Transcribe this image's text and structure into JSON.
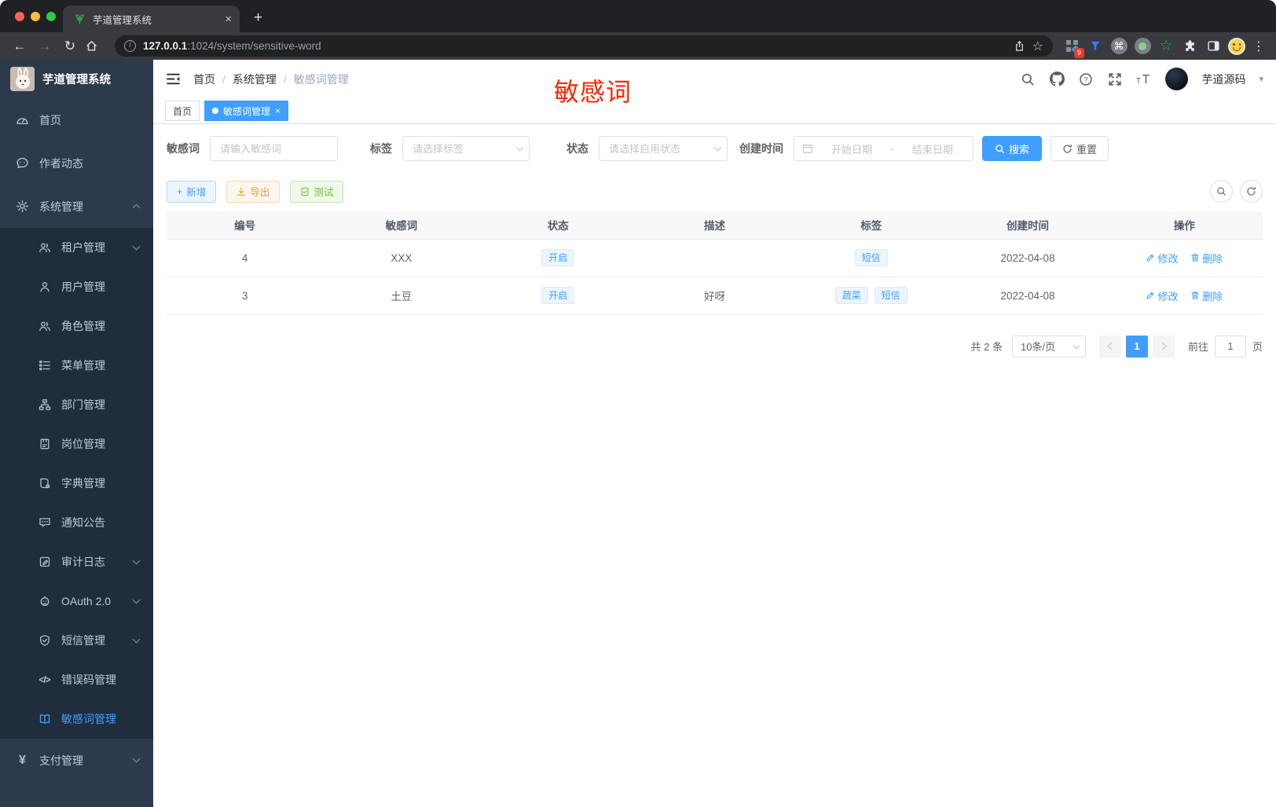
{
  "colors": {
    "accent": "#409eff",
    "annotation_red": "#ff2600",
    "sidebar_bg": "#2d3a4b",
    "submenu_bg": "#1f2d3d"
  },
  "glyphs": {
    "back": "←",
    "forward": "→",
    "reload": "↻",
    "star": "☆",
    "info": "i",
    "plus": "+",
    "close": "×",
    "more": "⋮",
    "cmd": "⌘",
    "caret_down": "▾",
    "slash": "/",
    "code": "</>",
    "yen": "¥",
    "green_star": "☆"
  },
  "browser": {
    "tab_title": "芋道管理系统",
    "url_host": "127.0.0.1",
    "url_rest": ":1024/system/sensitive-word",
    "extension_badge": "9"
  },
  "sidebar": {
    "app_title": "芋道管理系统",
    "items": [
      {
        "label": "首页",
        "icon": "dashboard-icon"
      },
      {
        "label": "作者动态",
        "icon": "chat-icon"
      },
      {
        "label": "系统管理",
        "icon": "gear-icon",
        "expanded": true
      },
      {
        "label": "租户管理",
        "icon": "users-icon",
        "collapsible": true
      },
      {
        "label": "用户管理",
        "icon": "user-icon"
      },
      {
        "label": "角色管理",
        "icon": "users-icon"
      },
      {
        "label": "菜单管理",
        "icon": "tree-list-icon"
      },
      {
        "label": "部门管理",
        "icon": "org-chart-icon"
      },
      {
        "label": "岗位管理",
        "icon": "badge-icon"
      },
      {
        "label": "字典管理",
        "icon": "book-icon"
      },
      {
        "label": "通知公告",
        "icon": "comment-icon"
      },
      {
        "label": "审计日志",
        "icon": "log-icon",
        "collapsible": true
      },
      {
        "label": "OAuth 2.0",
        "icon": "robot-icon",
        "collapsible": true
      },
      {
        "label": "短信管理",
        "icon": "shield-icon",
        "collapsible": true
      },
      {
        "label": "错误码管理",
        "icon": "code-icon"
      },
      {
        "label": "敏感词管理",
        "icon": "open-book-icon",
        "active": true
      },
      {
        "label": "支付管理",
        "icon": "yen-icon",
        "collapsible": true
      }
    ]
  },
  "header": {
    "breadcrumb": {
      "item1": "首页",
      "item2": "系统管理",
      "item3": "敏感词管理"
    },
    "username": "芋道源码"
  },
  "tabs": {
    "home_label": "首页",
    "active_label": "敏感词管理"
  },
  "annotation": {
    "text": "敏感词"
  },
  "filters": {
    "keyword_label": "敏感词",
    "keyword_placeholder": "请输入敏感词",
    "tag_label": "标签",
    "tag_placeholder": "请选择标签",
    "status_label": "状态",
    "status_placeholder": "请选择启用状态",
    "date_label": "创建时间",
    "date_start_placeholder": "开始日期",
    "date_sep": "-",
    "date_end_placeholder": "结束日期",
    "search_label": "搜索",
    "reset_label": "重置"
  },
  "toolbar": {
    "add_label": "新增",
    "export_label": "导出",
    "test_label": "测试"
  },
  "table": {
    "columns": [
      "编号",
      "敏感词",
      "状态",
      "描述",
      "标签",
      "创建时间",
      "操作"
    ],
    "edit_label": "修改",
    "delete_label": "删除",
    "rows": [
      {
        "id": "4",
        "word": "XXX",
        "status": "开启",
        "description": "",
        "tags": {
          "t0": "短信"
        },
        "created": "2022-04-08"
      },
      {
        "id": "3",
        "word": "土豆",
        "status": "开启",
        "description": "好呀",
        "tags": {
          "t0": "蔬菜",
          "t1": "短信"
        },
        "created": "2022-04-08"
      }
    ]
  },
  "pagination": {
    "total": "共 2 条",
    "page_size": "10条/页",
    "current_page": "1",
    "goto_label": "前往",
    "goto_value": "1",
    "page_unit": "页"
  }
}
